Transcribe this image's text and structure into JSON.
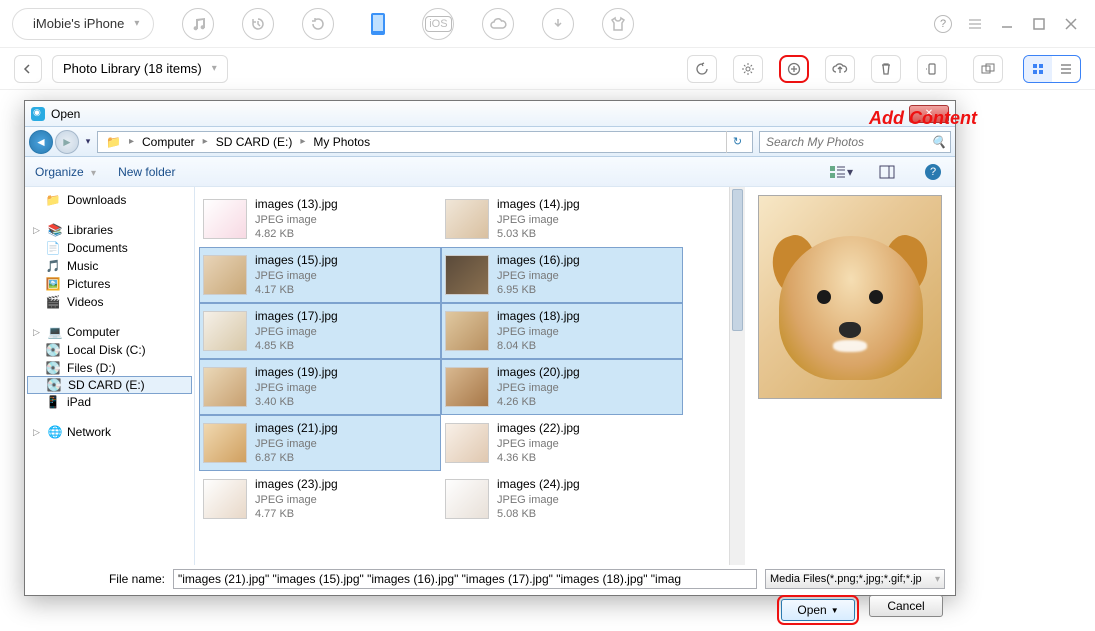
{
  "topbar": {
    "device_label": "iMobie's iPhone"
  },
  "subbar": {
    "library_label": "Photo Library (18 items)"
  },
  "annotation": {
    "add_content": "Add Content"
  },
  "dialog": {
    "title": "Open",
    "breadcrumb": {
      "root": "Computer",
      "drive": "SD CARD (E:)",
      "folder": "My Photos"
    },
    "search": {
      "placeholder": "Search My Photos"
    },
    "toolbar": {
      "organize": "Organize",
      "new_folder": "New folder"
    },
    "tree": {
      "downloads": "Downloads",
      "libraries": "Libraries",
      "documents": "Documents",
      "music": "Music",
      "pictures": "Pictures",
      "videos": "Videos",
      "computer": "Computer",
      "local_disk": "Local Disk (C:)",
      "files_d": "Files (D:)",
      "sd_card": "SD CARD (E:)",
      "ipad": "iPad",
      "network": "Network"
    },
    "files": [
      {
        "name": "images (13).jpg",
        "type": "JPEG image",
        "size": "4.82 KB",
        "selected": false
      },
      {
        "name": "images (14).jpg",
        "type": "JPEG image",
        "size": "5.03 KB",
        "selected": false
      },
      {
        "name": "images (15).jpg",
        "type": "JPEG image",
        "size": "4.17 KB",
        "selected": true
      },
      {
        "name": "images (16).jpg",
        "type": "JPEG image",
        "size": "6.95 KB",
        "selected": true
      },
      {
        "name": "images (17).jpg",
        "type": "JPEG image",
        "size": "4.85 KB",
        "selected": true
      },
      {
        "name": "images (18).jpg",
        "type": "JPEG image",
        "size": "8.04 KB",
        "selected": true
      },
      {
        "name": "images (19).jpg",
        "type": "JPEG image",
        "size": "3.40 KB",
        "selected": true
      },
      {
        "name": "images (20).jpg",
        "type": "JPEG image",
        "size": "4.26 KB",
        "selected": true
      },
      {
        "name": "images (21).jpg",
        "type": "JPEG image",
        "size": "6.87 KB",
        "selected": true
      },
      {
        "name": "images (22).jpg",
        "type": "JPEG image",
        "size": "4.36 KB",
        "selected": false
      },
      {
        "name": "images (23).jpg",
        "type": "JPEG image",
        "size": "4.77 KB",
        "selected": false
      },
      {
        "name": "images (24).jpg",
        "type": "JPEG image",
        "size": "5.08 KB",
        "selected": false
      }
    ],
    "filename_label": "File name:",
    "filename_value": "\"images (21).jpg\" \"images (15).jpg\" \"images (16).jpg\" \"images (17).jpg\" \"images (18).jpg\" \"imag",
    "filetype_value": "Media Files(*.png;*.jpg;*.gif;*.jp",
    "open_label": "Open",
    "cancel_label": "Cancel"
  }
}
